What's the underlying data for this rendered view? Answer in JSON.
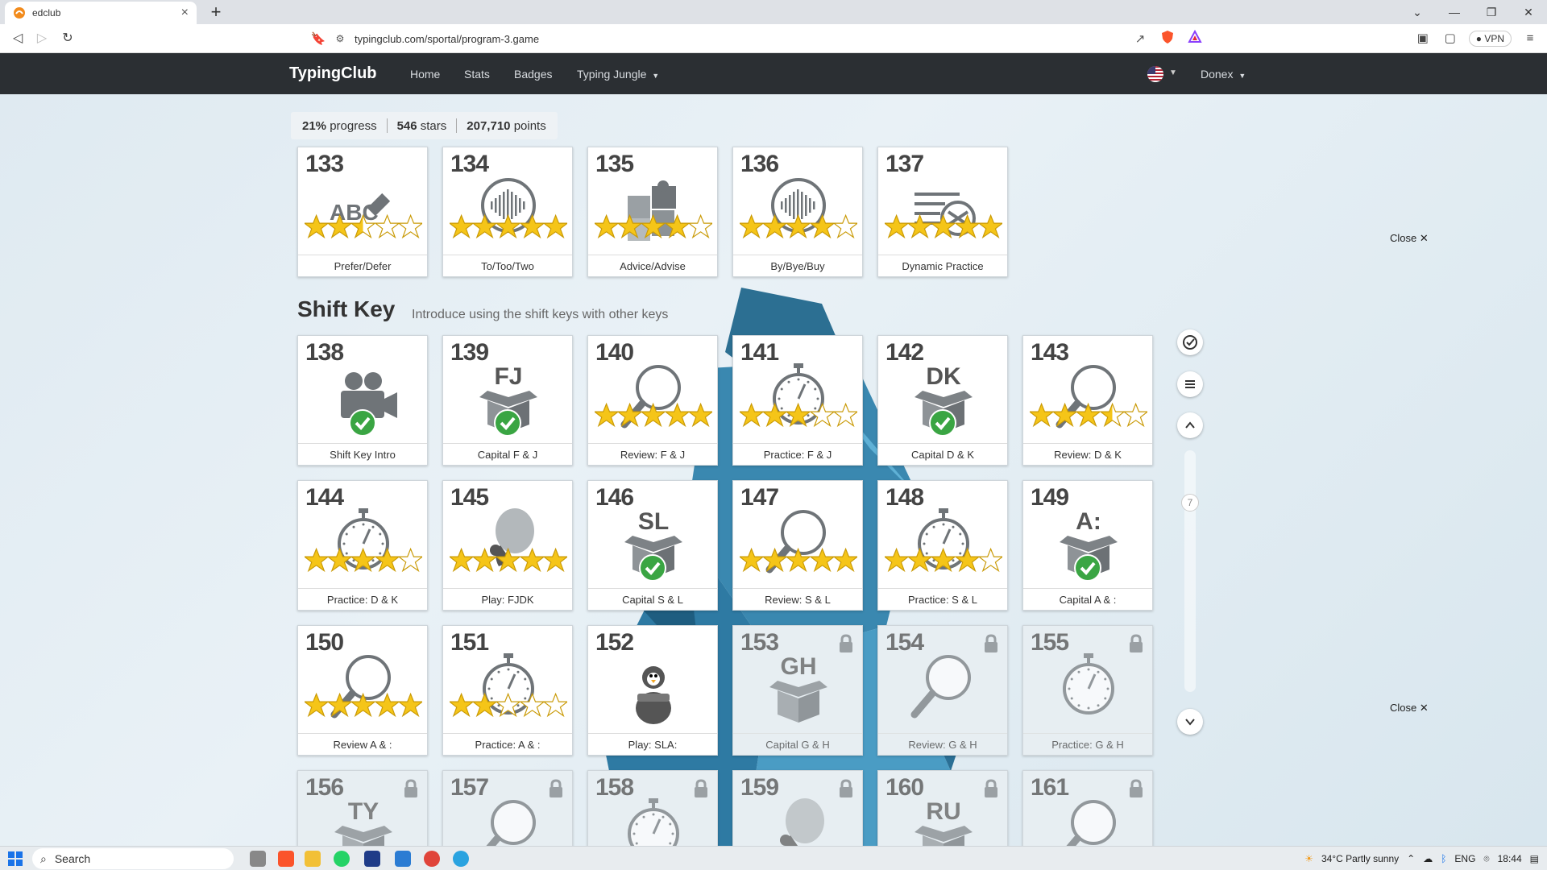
{
  "browser": {
    "tab_title": "edclub",
    "new_tab_icon": "plus-icon",
    "url": "typingclub.com/sportal/program-3.game",
    "vpn_label": "VPN"
  },
  "nav": {
    "brand": "TypingClub",
    "links": [
      "Home",
      "Stats",
      "Badges",
      "Typing Jungle"
    ],
    "user": "Donex"
  },
  "progress": {
    "percent": "21%",
    "percent_label": "progress",
    "stars": "546",
    "stars_label": "stars",
    "points": "207,710",
    "points_label": "points"
  },
  "close_label": "Close",
  "section": {
    "title": "Shift Key",
    "description": "Introduce using the shift keys with other keys"
  },
  "scroll_indicator": "7",
  "top_row": [
    {
      "num": "133",
      "label": "Prefer/Defer",
      "icon": "abc-eraser-icon",
      "stars": 2.5
    },
    {
      "num": "134",
      "label": "To/Too/Two",
      "icon": "audio-wave-icon",
      "stars": 5
    },
    {
      "num": "135",
      "label": "Advice/Advise",
      "icon": "puzzle-icon",
      "stars": 4
    },
    {
      "num": "136",
      "label": "By/Bye/Buy",
      "icon": "audio-wave-icon",
      "stars": 4
    },
    {
      "num": "137",
      "label": "Dynamic Practice",
      "icon": "shuffle-list-icon",
      "stars": 5
    }
  ],
  "lessons": [
    {
      "num": "138",
      "label": "Shift Key Intro",
      "icon": "video-camera-icon",
      "check": true
    },
    {
      "num": "139",
      "label": "Capital F & J",
      "icon": "box-icon",
      "letters": "FJ",
      "check": true
    },
    {
      "num": "140",
      "label": "Review: F & J",
      "icon": "magnifier-icon",
      "stars": 5
    },
    {
      "num": "141",
      "label": "Practice: F & J",
      "icon": "stopwatch-icon",
      "stars": 3
    },
    {
      "num": "142",
      "label": "Capital D & K",
      "icon": "box-icon",
      "letters": "DK",
      "check": true
    },
    {
      "num": "143",
      "label": "Review: D & K",
      "icon": "magnifier-icon",
      "stars": 3.5
    },
    {
      "num": "144",
      "label": "Practice: D & K",
      "icon": "stopwatch-icon",
      "stars": 4
    },
    {
      "num": "145",
      "label": "Play: FJDK",
      "icon": "balloon-game-icon",
      "stars": 5
    },
    {
      "num": "146",
      "label": "Capital S & L",
      "icon": "box-icon",
      "letters": "SL",
      "check": true
    },
    {
      "num": "147",
      "label": "Review: S & L",
      "icon": "magnifier-icon",
      "stars": 5
    },
    {
      "num": "148",
      "label": "Practice: S & L",
      "icon": "stopwatch-icon",
      "stars": 4
    },
    {
      "num": "149",
      "label": "Capital A & :",
      "icon": "box-icon",
      "letters": "A:",
      "check": true
    },
    {
      "num": "150",
      "label": "Review A & :",
      "icon": "magnifier-icon",
      "stars": 5
    },
    {
      "num": "151",
      "label": "Practice: A & :",
      "icon": "stopwatch-icon",
      "stars": 2
    },
    {
      "num": "152",
      "label": "Play: SLA:",
      "icon": "penguin-game-icon"
    },
    {
      "num": "153",
      "label": "Capital G & H",
      "icon": "box-icon",
      "letters": "GH",
      "locked": true
    },
    {
      "num": "154",
      "label": "Review: G & H",
      "icon": "magnifier-icon",
      "locked": true
    },
    {
      "num": "155",
      "label": "Practice: G & H",
      "icon": "stopwatch-icon",
      "locked": true
    },
    {
      "num": "156",
      "label": "",
      "icon": "box-icon",
      "letters": "TY",
      "locked": true
    },
    {
      "num": "157",
      "label": "",
      "icon": "magnifier-icon",
      "locked": true
    },
    {
      "num": "158",
      "label": "",
      "icon": "stopwatch-icon",
      "locked": true
    },
    {
      "num": "159",
      "label": "",
      "icon": "balloon-game-icon",
      "locked": true
    },
    {
      "num": "160",
      "label": "",
      "icon": "box-icon",
      "letters": "RU",
      "locked": true
    },
    {
      "num": "161",
      "label": "",
      "icon": "magnifier-icon",
      "locked": true
    }
  ],
  "taskbar": {
    "search_label": "Search",
    "weather": "34°C  Partly sunny",
    "lang": "ENG",
    "time": "18:44"
  }
}
